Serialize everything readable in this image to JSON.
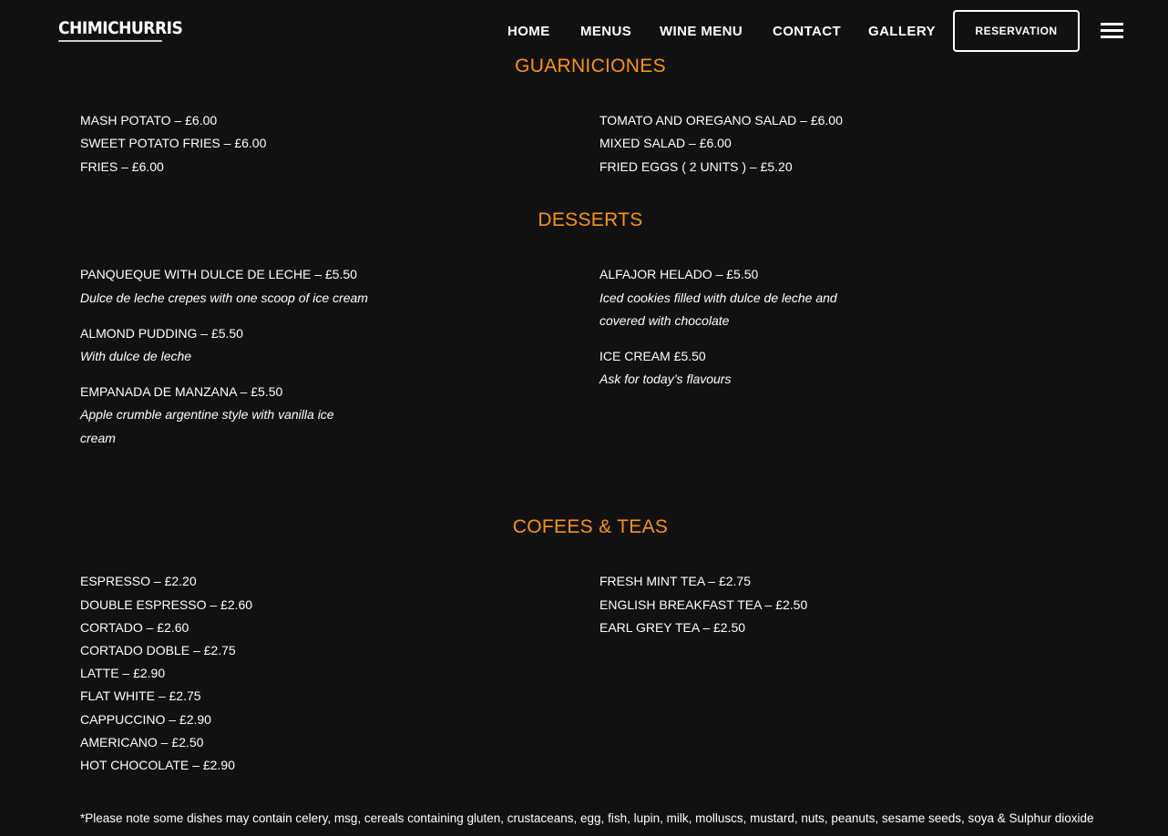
{
  "header": {
    "logo_text": "CHIMICHURRIS",
    "nav": [
      "HOME",
      "MENUS",
      "WINE MENU",
      "CONTACT",
      "GALLERY"
    ],
    "reservation_label": "RESERVATION",
    "menu_icon": "hamburger-menu-icon"
  },
  "sections": {
    "guarniciones": {
      "title": "GUARNICIONES",
      "left": [
        "MASH POTATO – £6.00",
        "SWEET POTATO FRIES – £6.00",
        "FRIES – £6.00"
      ],
      "right": [
        "TOMATO AND OREGANO SALAD – £6.00",
        "MIXED SALAD – £6.00",
        "FRIED EGGS ( 2 UNITS ) – £5.20"
      ]
    },
    "desserts": {
      "title": "DESSERTS",
      "left": [
        {
          "name": "PANQUEQUE WITH DULCE DE LECHE – £5.50",
          "desc": [
            "Dulce de leche crepes with one scoop of ice cream"
          ]
        },
        {
          "name": "ALMOND PUDDING  – £5.50",
          "desc": [
            "With dulce de leche"
          ]
        },
        {
          "name": "EMPANADA DE MANZANA  – £5.50",
          "desc": [
            "Apple crumble argentine style with vanilla ice",
            "cream"
          ]
        }
      ],
      "right": [
        {
          "name": "ALFAJOR HELADO  – £5.50",
          "desc": [
            "Iced cookies filled with dulce de leche and",
            "covered with chocolate"
          ]
        },
        {
          "name": "ICE CREAM  £5.50",
          "desc": [
            "Ask for today’s flavours"
          ]
        }
      ]
    },
    "coffees": {
      "title": "COFEES & TEAS",
      "left": [
        "ESPRESSO  – £2.20",
        "DOUBLE ESPRESSO – £2.60",
        "CORTADO – £2.60",
        "CORTADO DOBLE – £2.75",
        "LATTE  – £2.90",
        "FLAT WHITE  – £2.75",
        "CAPPUCCINO  – £2.90",
        "AMERICANO  – £2.50",
        "HOT CHOCOLATE  – £2.90"
      ],
      "right": [
        "FRESH MINT TEA  – £2.75",
        "ENGLISH BREAKFAST TEA  – £2.50",
        "EARL GREY TEA  – £2.50"
      ]
    }
  },
  "footnote": "*Please note some dishes may contain celery, msg, cereals containing gluten, crustaceans, egg, fish, lupin, milk, molluscs, mustard, nuts, peanuts, sesame seeds, soya & Sulphur dioxide",
  "colors": {
    "background": "#111111",
    "accent": "#f7931e",
    "text": "#ffffff"
  }
}
